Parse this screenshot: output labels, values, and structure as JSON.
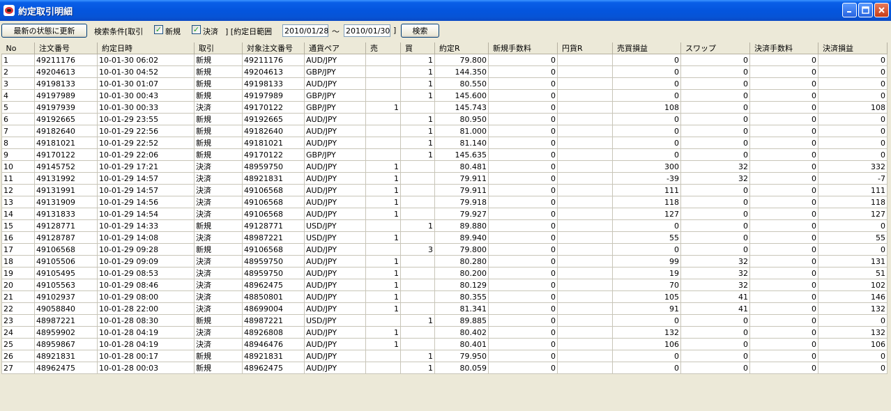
{
  "window": {
    "title": "約定取引明細"
  },
  "toolbar": {
    "refresh_label": "最新の状態に更新",
    "search_cond_label": "検索条件[取引",
    "new_label": "新規",
    "settle_label": "決済",
    "range_label": "] [約定日範囲",
    "date_from": "2010/01/28",
    "tilde": "～",
    "date_to": "2010/01/30",
    "close_bracket": "]",
    "search_label": "検索"
  },
  "table": {
    "columns": [
      "No",
      "注文番号",
      "約定日時",
      "取引",
      "対象注文番号",
      "通貨ペア",
      "売",
      "買",
      "約定R",
      "新規手数料",
      "円貨R",
      "売買損益",
      "スワップ",
      "決済手数料",
      "決済損益"
    ],
    "rows": [
      [
        "1",
        "49211176",
        "10-01-30 06:02",
        "新規",
        "49211176",
        "AUD/JPY",
        "",
        "1",
        "79.800",
        "0",
        "",
        "0",
        "0",
        "0",
        "0"
      ],
      [
        "2",
        "49204613",
        "10-01-30 04:52",
        "新規",
        "49204613",
        "GBP/JPY",
        "",
        "1",
        "144.350",
        "0",
        "",
        "0",
        "0",
        "0",
        "0"
      ],
      [
        "3",
        "49198133",
        "10-01-30 01:07",
        "新規",
        "49198133",
        "AUD/JPY",
        "",
        "1",
        "80.550",
        "0",
        "",
        "0",
        "0",
        "0",
        "0"
      ],
      [
        "4",
        "49197989",
        "10-01-30 00:43",
        "新規",
        "49197989",
        "GBP/JPY",
        "",
        "1",
        "145.600",
        "0",
        "",
        "0",
        "0",
        "0",
        "0"
      ],
      [
        "5",
        "49197939",
        "10-01-30 00:33",
        "決済",
        "49170122",
        "GBP/JPY",
        "1",
        "",
        "145.743",
        "0",
        "",
        "108",
        "0",
        "0",
        "108"
      ],
      [
        "6",
        "49192665",
        "10-01-29 23:55",
        "新規",
        "49192665",
        "AUD/JPY",
        "",
        "1",
        "80.950",
        "0",
        "",
        "0",
        "0",
        "0",
        "0"
      ],
      [
        "7",
        "49182640",
        "10-01-29 22:56",
        "新規",
        "49182640",
        "AUD/JPY",
        "",
        "1",
        "81.000",
        "0",
        "",
        "0",
        "0",
        "0",
        "0"
      ],
      [
        "8",
        "49181021",
        "10-01-29 22:52",
        "新規",
        "49181021",
        "AUD/JPY",
        "",
        "1",
        "81.140",
        "0",
        "",
        "0",
        "0",
        "0",
        "0"
      ],
      [
        "9",
        "49170122",
        "10-01-29 22:06",
        "新規",
        "49170122",
        "GBP/JPY",
        "",
        "1",
        "145.635",
        "0",
        "",
        "0",
        "0",
        "0",
        "0"
      ],
      [
        "10",
        "49145752",
        "10-01-29 17:21",
        "決済",
        "48959750",
        "AUD/JPY",
        "1",
        "",
        "80.481",
        "0",
        "",
        "300",
        "32",
        "0",
        "332"
      ],
      [
        "11",
        "49131992",
        "10-01-29 14:57",
        "決済",
        "48921831",
        "AUD/JPY",
        "1",
        "",
        "79.911",
        "0",
        "",
        "-39",
        "32",
        "0",
        "-7"
      ],
      [
        "12",
        "49131991",
        "10-01-29 14:57",
        "決済",
        "49106568",
        "AUD/JPY",
        "1",
        "",
        "79.911",
        "0",
        "",
        "111",
        "0",
        "0",
        "111"
      ],
      [
        "13",
        "49131909",
        "10-01-29 14:56",
        "決済",
        "49106568",
        "AUD/JPY",
        "1",
        "",
        "79.918",
        "0",
        "",
        "118",
        "0",
        "0",
        "118"
      ],
      [
        "14",
        "49131833",
        "10-01-29 14:54",
        "決済",
        "49106568",
        "AUD/JPY",
        "1",
        "",
        "79.927",
        "0",
        "",
        "127",
        "0",
        "0",
        "127"
      ],
      [
        "15",
        "49128771",
        "10-01-29 14:33",
        "新規",
        "49128771",
        "USD/JPY",
        "",
        "1",
        "89.880",
        "0",
        "",
        "0",
        "0",
        "0",
        "0"
      ],
      [
        "16",
        "49128787",
        "10-01-29 14:08",
        "決済",
        "48987221",
        "USD/JPY",
        "1",
        "",
        "89.940",
        "0",
        "",
        "55",
        "0",
        "0",
        "55"
      ],
      [
        "17",
        "49106568",
        "10-01-29 09:28",
        "新規",
        "49106568",
        "AUD/JPY",
        "",
        "3",
        "79.800",
        "0",
        "",
        "0",
        "0",
        "0",
        "0"
      ],
      [
        "18",
        "49105506",
        "10-01-29 09:09",
        "決済",
        "48959750",
        "AUD/JPY",
        "1",
        "",
        "80.280",
        "0",
        "",
        "99",
        "32",
        "0",
        "131"
      ],
      [
        "19",
        "49105495",
        "10-01-29 08:53",
        "決済",
        "48959750",
        "AUD/JPY",
        "1",
        "",
        "80.200",
        "0",
        "",
        "19",
        "32",
        "0",
        "51"
      ],
      [
        "20",
        "49105563",
        "10-01-29 08:46",
        "決済",
        "48962475",
        "AUD/JPY",
        "1",
        "",
        "80.129",
        "0",
        "",
        "70",
        "32",
        "0",
        "102"
      ],
      [
        "21",
        "49102937",
        "10-01-29 08:00",
        "決済",
        "48850801",
        "AUD/JPY",
        "1",
        "",
        "80.355",
        "0",
        "",
        "105",
        "41",
        "0",
        "146"
      ],
      [
        "22",
        "49058840",
        "10-01-28 22:00",
        "決済",
        "48699004",
        "AUD/JPY",
        "1",
        "",
        "81.341",
        "0",
        "",
        "91",
        "41",
        "0",
        "132"
      ],
      [
        "23",
        "48987221",
        "10-01-28 08:30",
        "新規",
        "48987221",
        "USD/JPY",
        "",
        "1",
        "89.885",
        "0",
        "",
        "0",
        "0",
        "0",
        "0"
      ],
      [
        "24",
        "48959902",
        "10-01-28 04:19",
        "決済",
        "48926808",
        "AUD/JPY",
        "1",
        "",
        "80.402",
        "0",
        "",
        "132",
        "0",
        "0",
        "132"
      ],
      [
        "25",
        "48959867",
        "10-01-28 04:19",
        "決済",
        "48946476",
        "AUD/JPY",
        "1",
        "",
        "80.401",
        "0",
        "",
        "106",
        "0",
        "0",
        "106"
      ],
      [
        "26",
        "48921831",
        "10-01-28 00:17",
        "新規",
        "48921831",
        "AUD/JPY",
        "",
        "1",
        "79.950",
        "0",
        "",
        "0",
        "0",
        "0",
        "0"
      ],
      [
        "27",
        "48962475",
        "10-01-28 00:03",
        "新規",
        "48962475",
        "AUD/JPY",
        "",
        "1",
        "80.059",
        "0",
        "",
        "0",
        "0",
        "0",
        "0"
      ]
    ]
  }
}
